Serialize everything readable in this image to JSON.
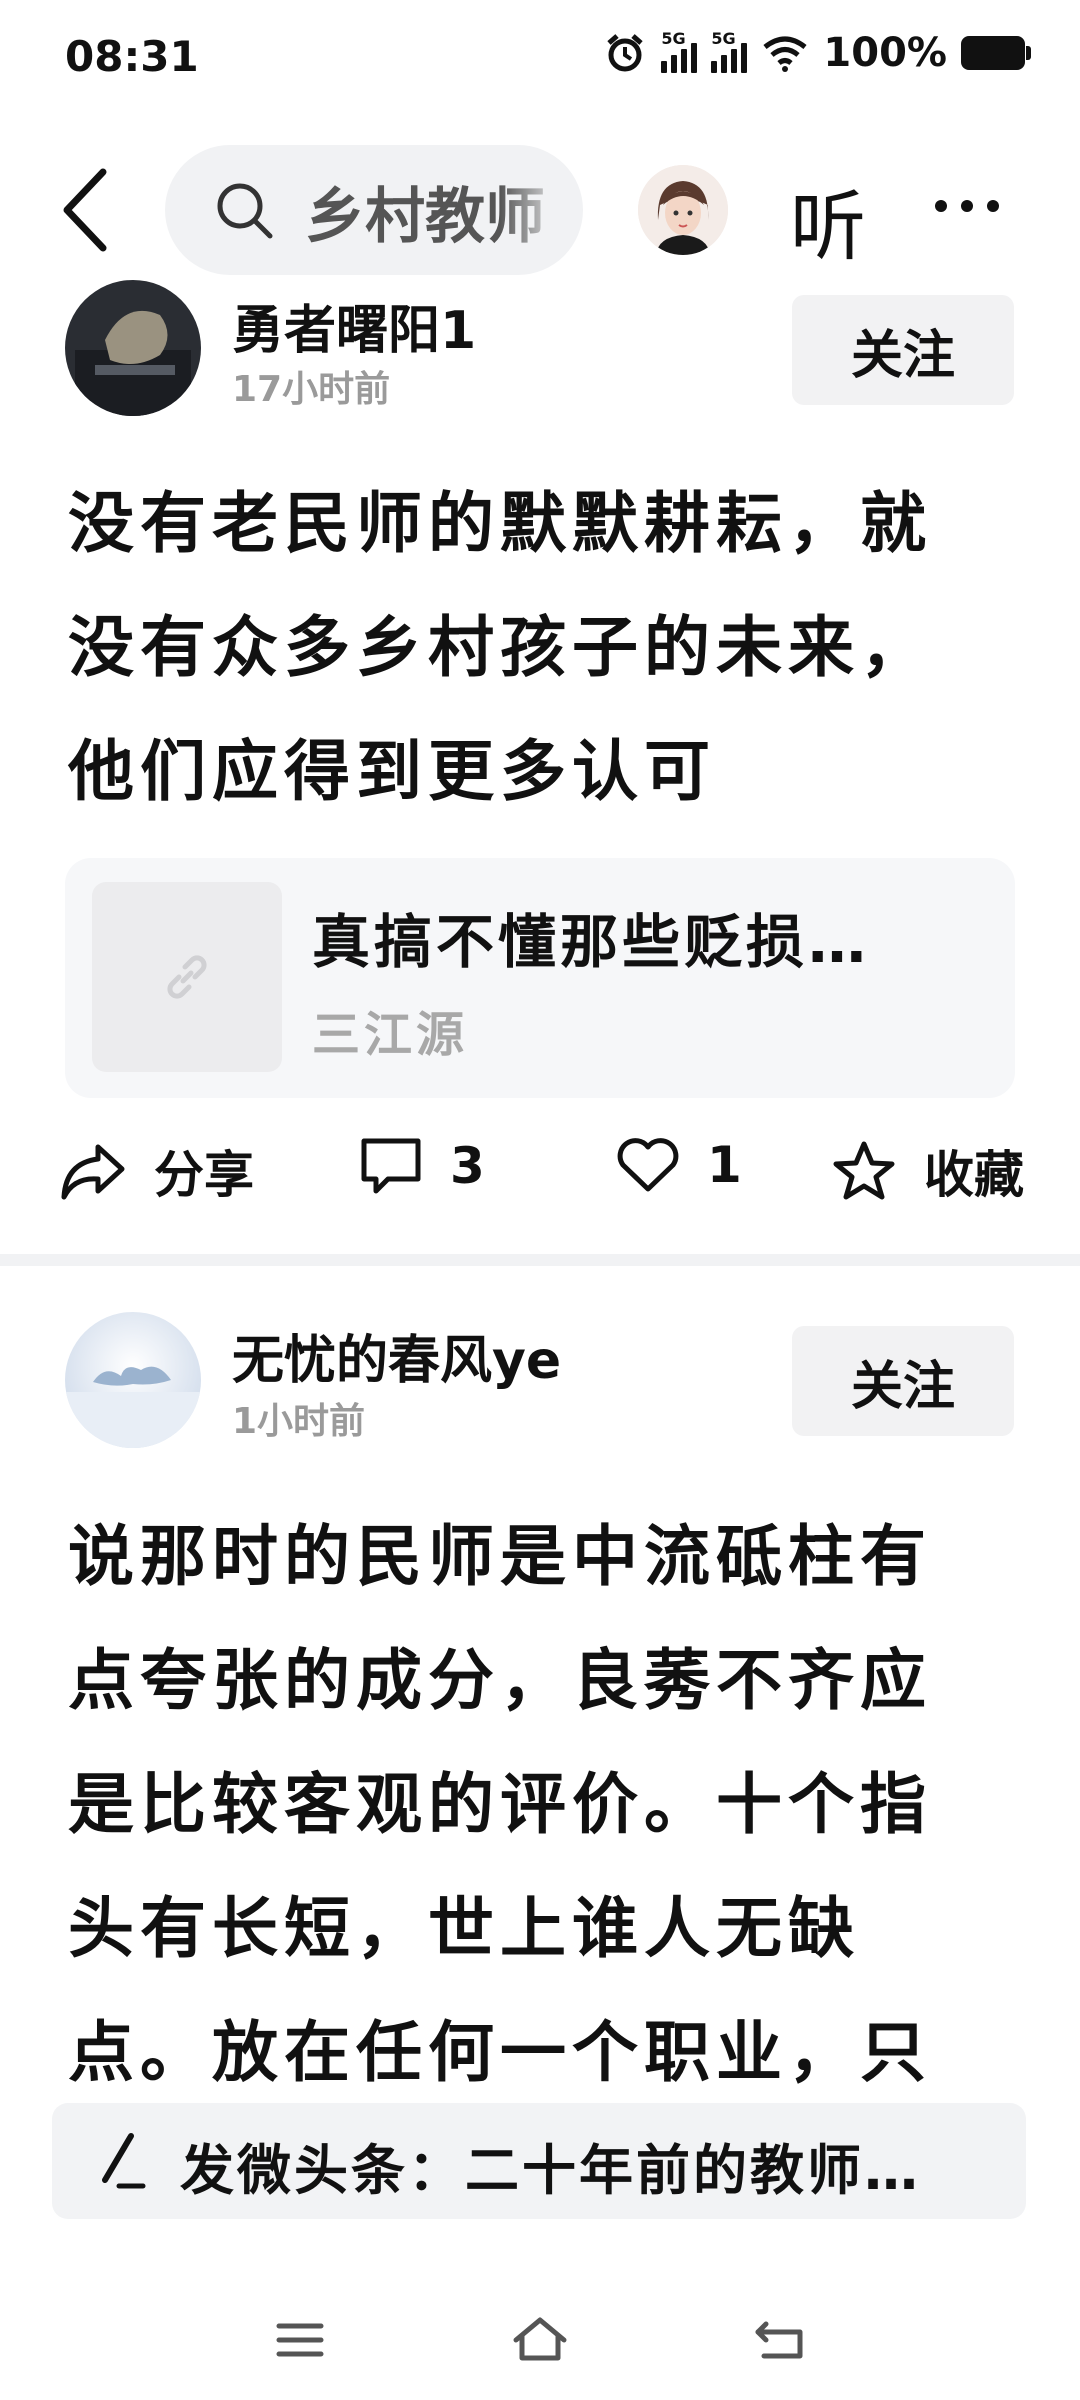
{
  "status_bar": {
    "time": "08:31",
    "net1": "5G",
    "net2": "5G",
    "battery": "100%"
  },
  "header": {
    "search_query": "乡村教师",
    "listen_label": "听"
  },
  "posts": [
    {
      "author": "勇者曙阳1",
      "time": "17小时前",
      "follow_label": "关注",
      "text_lines": [
        "没有老民师的默默耕耘，就",
        "没有众多乡村孩子的未来，",
        "他们应得到更多认可"
      ],
      "link": {
        "title": "真搞不懂那些贬损…",
        "source": "三江源"
      },
      "actions": {
        "share": "分享",
        "comments": "3",
        "likes": "1",
        "favorite": "收藏"
      }
    },
    {
      "author": "无忧的春风ye",
      "time": "1小时前",
      "follow_label": "关注",
      "text_lines": [
        "说那时的民师是中流砥柱有",
        "点夸张的成分，良莠不齐应",
        "是比较客观的评价。十个指",
        "头有长短，世上谁人无缺",
        "点。放在任何一个职业，只"
      ]
    }
  ],
  "composer": {
    "text": "发微头条：二十年前的教师…"
  },
  "icons": [
    "back-icon",
    "search-icon",
    "more-icon",
    "share-icon",
    "comment-icon",
    "like-icon",
    "favorite-icon",
    "link-icon",
    "pen-icon",
    "menu-icon",
    "home-icon",
    "back-nav-icon"
  ]
}
